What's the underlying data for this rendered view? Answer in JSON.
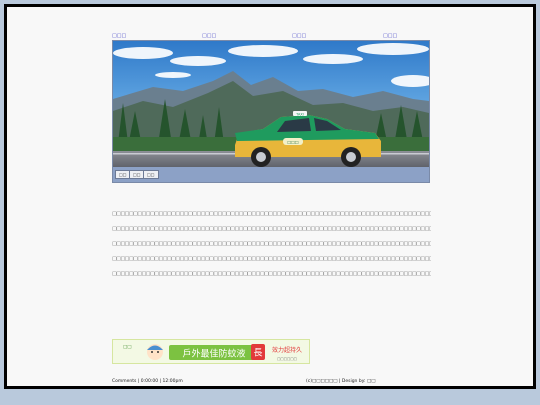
{
  "nav": {
    "links": [
      "□□□",
      "□□□",
      "□□□",
      "□□□"
    ]
  },
  "banner": {
    "plate_text": "□□□",
    "taxi_sign": "TAXI",
    "buttons": [
      "□□",
      "□□",
      "□□"
    ]
  },
  "content": {
    "lines": [
      "□□□□□□□□□□□□□□□□□□□□□□□□□□□□□□□□□□□□□□□□□□□□□□□□□□□□□□□□□□□□□□□□□□□□□□□□□□□□□□□□□□□□□□□□□□□□",
      "□□□□□□□□□□□□□□□□□□□□□□□□□□□□□□□□□□□□□□□□□□□□□□□□□□□□□□□□□□□□□□□□□□□□□□□□□□□□□□□□□□□□□□□□□□□□",
      "□□□□□□□□□□□□□□□□□□□□□□□□□□□□□□□□□□□□□□□□□□□□□□□□□□□□□□□□□□□□□□□□□□□□□□□□□□□□□□□□□□□□□□□□",
      "□□□□□□□□□□□□□□□□□□□□□□□□□□□□□□□□□□□□□□□□□□□□□□□□□□□□□□□□□□□□□□□□□□□□□□□□□□□□□□□□□□□□□□□□□□□□",
      "□□□□□□□□□□□□□□□□□□□□□□□□□□□□□□□□□□□□□□□□□□□□□□□□□□□□□□□□□□□□□□□□□□□□□□□□□□□□□□"
    ]
  },
  "ad": {
    "brand": "□□",
    "headline": "戶外最佳防蚊液",
    "badge": "長",
    "slogan": "效力超持久",
    "subtext": "□□□□□□"
  },
  "footer": {
    "left": "Comments | 0:00:00 | 12:00pm",
    "right": "(c)□□□□□□ | Design by: □□"
  },
  "colors": {
    "link": "#3d3dc4",
    "ad_green": "#7cc241",
    "taxi_green": "#1f9b5e",
    "taxi_yellow": "#e8b63a"
  }
}
